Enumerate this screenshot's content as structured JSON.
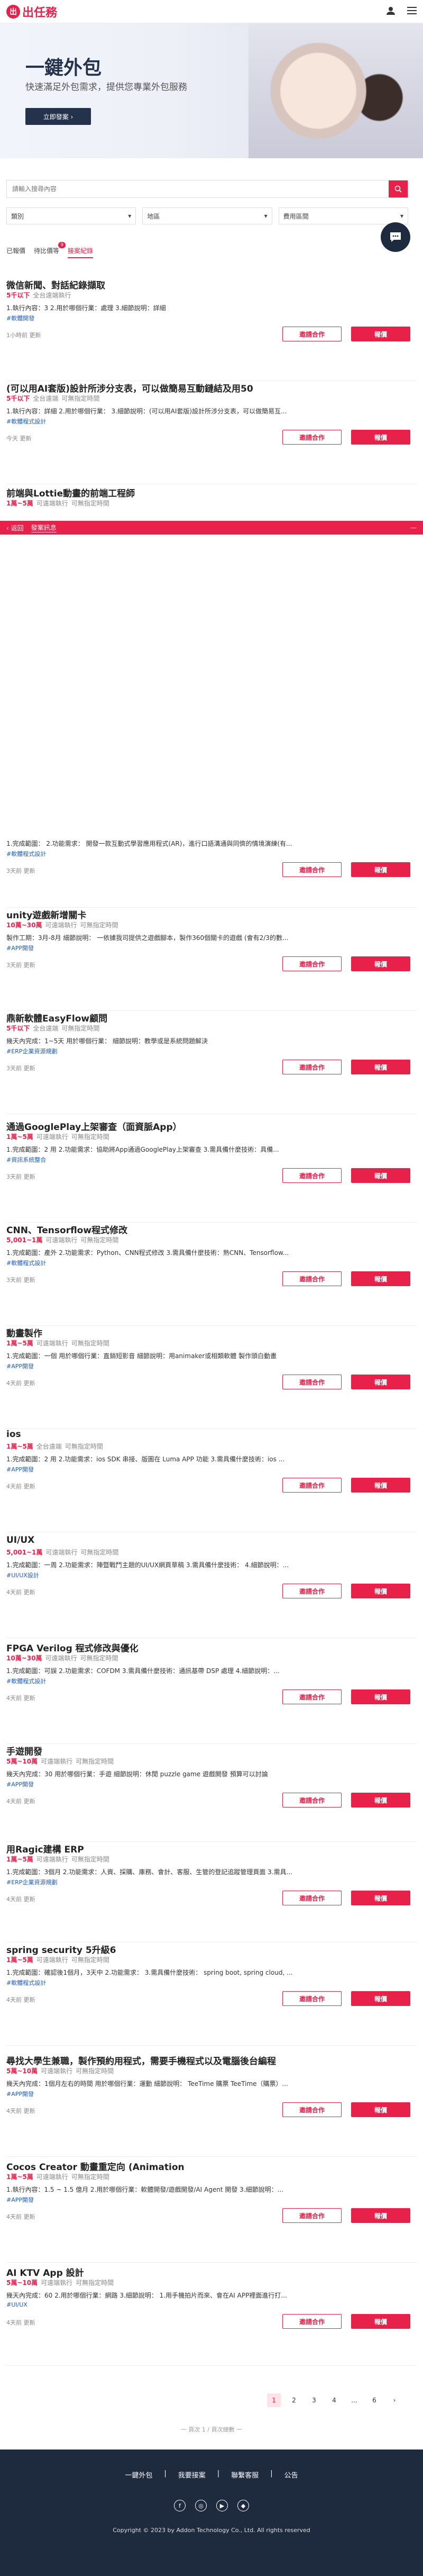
{
  "header": {
    "logo_text": "出任務",
    "logo_mark": "出"
  },
  "hero": {
    "title": "一鍵外包",
    "subtitle": "快速滿足外包需求，提供您專業外包服務",
    "cta": "立即發案 ›"
  },
  "search": {
    "placeholder": "請輸入搜尋內容"
  },
  "filters": {
    "category": "類別",
    "area": "地區",
    "budget": "費用區間"
  },
  "tabs": [
    {
      "label": "已報價",
      "badge": ""
    },
    {
      "label": "待比價等",
      "badge": "9"
    },
    {
      "label": "接案紀錄",
      "badge": ""
    }
  ],
  "jobs": [
    {
      "title": "微信新聞、對話紀錄擷取",
      "budget": "5千以下",
      "loc": "全台遠端執行",
      "time": "",
      "desc": "1.執行內容：3 2.用於哪個行業：處理 3.細節說明：詳細",
      "tag": "#軟體開發",
      "ago": "1小時前 更新"
    },
    {
      "title": "(可以用AI套版)設計所涉分支表，可以做簡易互動鏈結及用50",
      "budget": "5千以下",
      "loc": "全台遠端",
      "time": "可無指定時間",
      "desc": "1.執行內容：詳細 2.用於哪個行業： 3.細節說明：(可以用AI套版)設計所涉分支表，可以做簡易互...",
      "tag": "#軟體程式設計",
      "ago": "今天 更新"
    },
    {
      "title": "前端與Lottie動畫的前端工程師",
      "budget": "1萬~5萬",
      "loc": "可遠端執行",
      "time": "可無指定時間",
      "desc": "",
      "tag": "",
      "ago": ""
    },
    {
      "title": "",
      "budget": "",
      "loc": "",
      "time": "",
      "desc": "1.完成範圍： 2.功能需求： 開發一款互動式學習應用程式(AR)，進行口語溝通與同儕的情境演練(有...",
      "tag": "#軟體程式設計",
      "ago": "3天前 更新"
    },
    {
      "title": "unity遊戲新增關卡",
      "budget": "10萬~30萬",
      "loc": "可遠端執行",
      "time": "可無指定時間",
      "desc": "製作工期：3月-8月 細節說明： 一依據我司提供之遊戲腳本，製作360個關卡的遊戲 (會有2/3的數...",
      "tag": "#APP開發",
      "ago": "3天前 更新"
    },
    {
      "title": "鼎新軟體EasyFlow顧問",
      "budget": "5千以下",
      "loc": "全台遠端",
      "time": "可無指定時間",
      "desc": "幾天內完成：1~5天 用於哪個行業： 細節說明：教學或是系統問題解決",
      "tag": "#ERP企業資源規劃",
      "ago": "3天前 更新"
    },
    {
      "title": "通過GooglePlay上架審查（面資脈App）",
      "budget": "1萬~5萬",
      "loc": "可遠端執行",
      "time": "可無指定時間",
      "desc": "1.完成範圍：2 用 2.功能需求：協助將App通過GooglePlay上架審查 3.需具備什麼技術：具備...",
      "tag": "#資訊系統整合",
      "ago": "3天前 更新"
    },
    {
      "title": "CNN、Tensorflow程式修改",
      "budget": "5,001~1萬",
      "loc": "可遠端執行",
      "time": "可無指定時間",
      "desc": "1.完成範圍：產外 2.功能需求：Python、CNN程式修改 3.需具備什麼技術：熟CNN、Tensorflow...",
      "tag": "#軟體程式設計",
      "ago": "3天前 更新"
    },
    {
      "title": "動畫製作",
      "budget": "1萬~5萬",
      "loc": "可遠端執行",
      "time": "可無指定時間",
      "desc": "1.完成範圍：一個 用於哪個行業：直銷短影音 細節說明：用animaker或相類軟體 製作頭白動畫",
      "tag": "#APP開發",
      "ago": "4天前 更新"
    },
    {
      "title": "ios",
      "budget": "1萬~5萬",
      "loc": "全台遠端",
      "time": "可無指定時間",
      "desc": "1.完成範圍：2 用 2.功能需求：ios SDK 串接、版圖在 Luma APP 功能 3.需具備什麼技術：ios ...",
      "tag": "#APP開發",
      "ago": "4天前 更新"
    },
    {
      "title": "UI/UX",
      "budget": "5,001~1萬",
      "loc": "可遠端執行",
      "time": "可無指定時間",
      "desc": "1.完成範圍：一周 2.功能需求：陣暨戰鬥主題的UI/UX網頁草稿 3.需具備什麼技術： 4.細節說明：...",
      "tag": "#UI/UX設計",
      "ago": "4天前 更新"
    },
    {
      "title": "FPGA Verilog 程式修改與優化",
      "budget": "10萬~30萬",
      "loc": "可遠端執行",
      "time": "可無指定時間",
      "desc": "1.完成範圍：可誤 2.功能需求：COFDM 3.需具備什麼技術：通訊基帶 DSP 處理 4.細節說明：...",
      "tag": "#軟體程式設計",
      "ago": "4天前 更新"
    },
    {
      "title": "手遊開發",
      "budget": "5萬~10萬",
      "loc": "可遠端執行",
      "time": "可無指定時間",
      "desc": "幾天內完成：30 用於哪個行業：手遊 細節說明：休閒 puzzle game 遊戲開發 預算可以討論",
      "tag": "#APP開發",
      "ago": "4天前 更新"
    },
    {
      "title": "用Ragic建構 ERP",
      "budget": "1萬~5萬",
      "loc": "可遠端執行",
      "time": "可無指定時間",
      "desc": "1.完成範圍：3個月 2.功能需求：人資、採購、庫務、會計、客服、生管的登記追蹤管理頁面 3.需具...",
      "tag": "#ERP企業資源規劃",
      "ago": "4天前 更新"
    },
    {
      "title": "spring security 5升級6",
      "budget": "1萬~5萬",
      "loc": "可遠端執行",
      "time": "可無指定時間",
      "desc": "1.完成範圍：確認後1個月，3天中 2.功能需求： 3.需具備什麼技術： spring boot, spring cloud, ...",
      "tag": "#軟體程式設計",
      "ago": "4天前 更新"
    },
    {
      "title": "尋找大學生兼職，製作預約用程式，需要手機程式以及電腦後台編程",
      "budget": "5萬~10萬",
      "loc": "可遠端執行",
      "time": "可無指定時間",
      "desc": "幾天內完成：1個月左右的時間 用於哪個行業：運動 細節說明： TeeTime 購票 TeeTime（購票）...",
      "tag": "#APP開發",
      "ago": "4天前 更新"
    },
    {
      "title": "Cocos Creator 動畫重定向 (Animation",
      "budget": "1萬~5萬",
      "loc": "可遠端執行",
      "time": "可無指定時間",
      "desc": "1.執行內容：1.5 ~ 1.5 億月 2.用於哪個行業：軟體開發/遊戲開發/AI Agent 開發 3.細節說明：...",
      "tag": "#APP開發",
      "ago": "4天前 更新"
    },
    {
      "title": "AI KTV App 設計",
      "budget": "5萬~10萬",
      "loc": "可遠端執行",
      "time": "可無指定時間",
      "desc": "幾天內完成：60 2.用於哪個行業：網路 3.細節說明： 1.用手機拍片而來、會在AI APP裡面進行打...",
      "tag": "#UI/UX",
      "ago": "4天前 更新"
    }
  ],
  "buttons": {
    "invite": "邀請合作",
    "join": "報價"
  },
  "overlay": {
    "back": "‹ 返回",
    "title": "發案訊息",
    "close": "—"
  },
  "pagination": {
    "pages": [
      "1",
      "2",
      "3",
      "4",
      "...",
      "6",
      "›"
    ]
  },
  "hint": "一 頁次 1 / 頁次總數 一",
  "footer": {
    "nav": [
      "一鍵外包",
      "我要接案",
      "聯繫客服",
      "公告"
    ],
    "social": [
      "f",
      "◎",
      "▶",
      "◆"
    ],
    "copyright": "Copyright © 2023 by Addon Technology Co., Ltd. All rights reserved"
  },
  "colors": {
    "accent": "#e8214a",
    "dark": "#1e2a3e"
  }
}
